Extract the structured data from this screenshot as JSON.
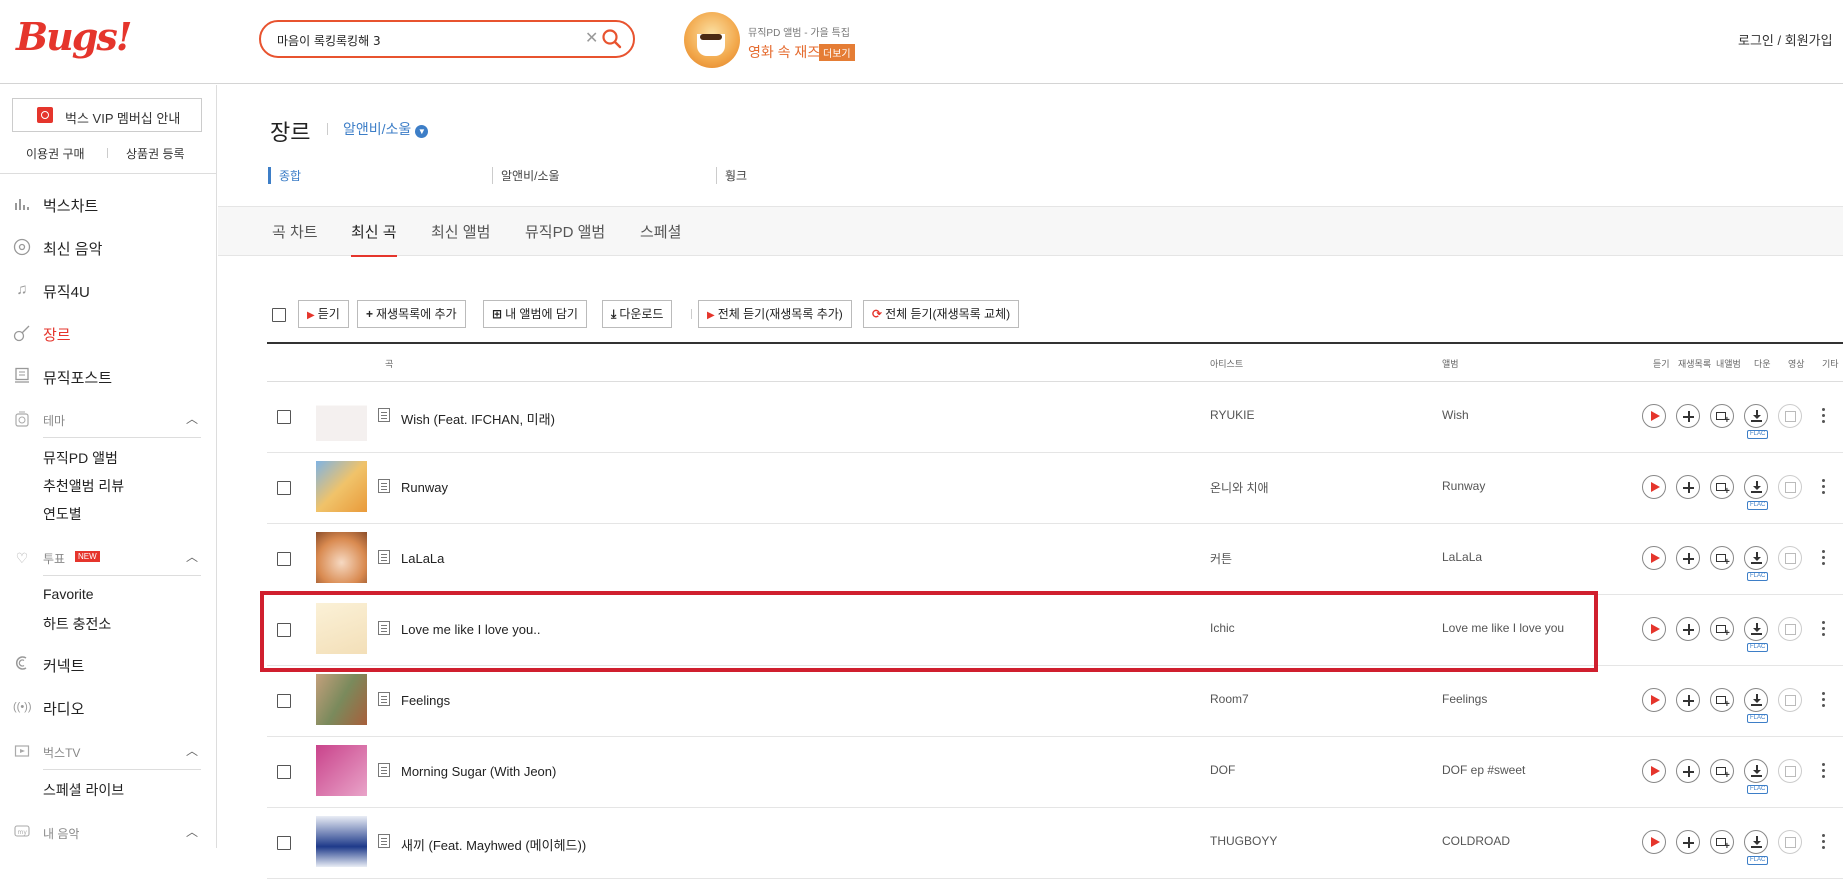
{
  "header": {
    "logo": "Bugs!",
    "search": {
      "value": "마음이 록킹록킹해 3",
      "placeholder": ""
    },
    "promo": {
      "subtitle": "뮤직PD 앨범 - 가을 특집",
      "title": "영화 속 재즈",
      "more": "더보기"
    },
    "login": "로그인",
    "login_sep": " / ",
    "signup": "회원가입"
  },
  "sidebar": {
    "vip": "벅스 VIP 멤버십 안내",
    "buy_ticket": "이용권 구매",
    "gift_register": "상품권 등록",
    "nav": [
      {
        "label": "벅스차트",
        "icon": "chart-icon"
      },
      {
        "label": "최신 음악",
        "icon": "disc-icon"
      },
      {
        "label": "뮤직4U",
        "icon": "note-icon"
      },
      {
        "label": "장르",
        "icon": "guitar-icon",
        "active": true
      },
      {
        "label": "뮤직포스트",
        "icon": "post-icon"
      }
    ],
    "theme": {
      "label": "테마",
      "items": [
        "뮤직PD 앨범",
        "추천앨범 리뷰",
        "연도별"
      ]
    },
    "vote": {
      "label": "투표",
      "badge": "NEW",
      "items": [
        "Favorite",
        "하트 충전소"
      ]
    },
    "connect": "커넥트",
    "radio": "라디오",
    "bugstv": {
      "label": "벅스TV",
      "items": [
        "스페셜 라이브"
      ]
    },
    "my_music": "내 음악"
  },
  "main": {
    "title": "장르",
    "genre": "알앤비/소울",
    "subnav": [
      "종합",
      "알앤비/소울",
      "훵크"
    ],
    "tabs": [
      "곡 차트",
      "최신 곡",
      "최신 앨범",
      "뮤직PD 앨범",
      "스페셜"
    ],
    "active_tab": 1,
    "toolbar": {
      "listen": "듣기",
      "add_playlist": "재생목록에 추가",
      "add_album": "내 앨범에 담기",
      "download": "다운로드",
      "listen_all_add": "전체 듣기(재생목록 추가)",
      "listen_all_replace": "전체 듣기(재생목록 교체)"
    },
    "columns": {
      "song": "곡",
      "artist": "아티스트",
      "album": "앨범",
      "listen": "듣기",
      "playlist": "재생목록",
      "my_album": "내앨범",
      "download": "다운",
      "video": "영상",
      "etc": "기타"
    },
    "tracks": [
      {
        "title": "Wish (Feat. IFCHAN, 미래)",
        "artist": "RYUKIE",
        "album": "Wish",
        "flac": "FLAC"
      },
      {
        "title": "Runway",
        "artist": "온니와 치애",
        "album": "Runway",
        "flac": "FLAC"
      },
      {
        "title": "LaLaLa",
        "artist": "커튼",
        "album": "LaLaLa",
        "flac": "FLAC"
      },
      {
        "title": "Love me like I love you..",
        "artist": "Ichic",
        "album": "Love me like I love you",
        "flac": "FLAC"
      },
      {
        "title": "Feelings",
        "artist": "Room7",
        "album": "Feelings",
        "flac": "FLAC"
      },
      {
        "title": "Morning Sugar (With Jeon)",
        "artist": "DOF",
        "album": "DOF ep #sweet",
        "flac": "FLAC"
      },
      {
        "title": "새끼 (Feat. Mayhwed (메이헤드))",
        "artist": "THUGBOYY",
        "album": "COLDROAD",
        "flac": "FLAC"
      }
    ]
  },
  "colors": {
    "accent": "#e5352c",
    "link": "#3d7ec7",
    "highlight": "#d01f2e"
  }
}
